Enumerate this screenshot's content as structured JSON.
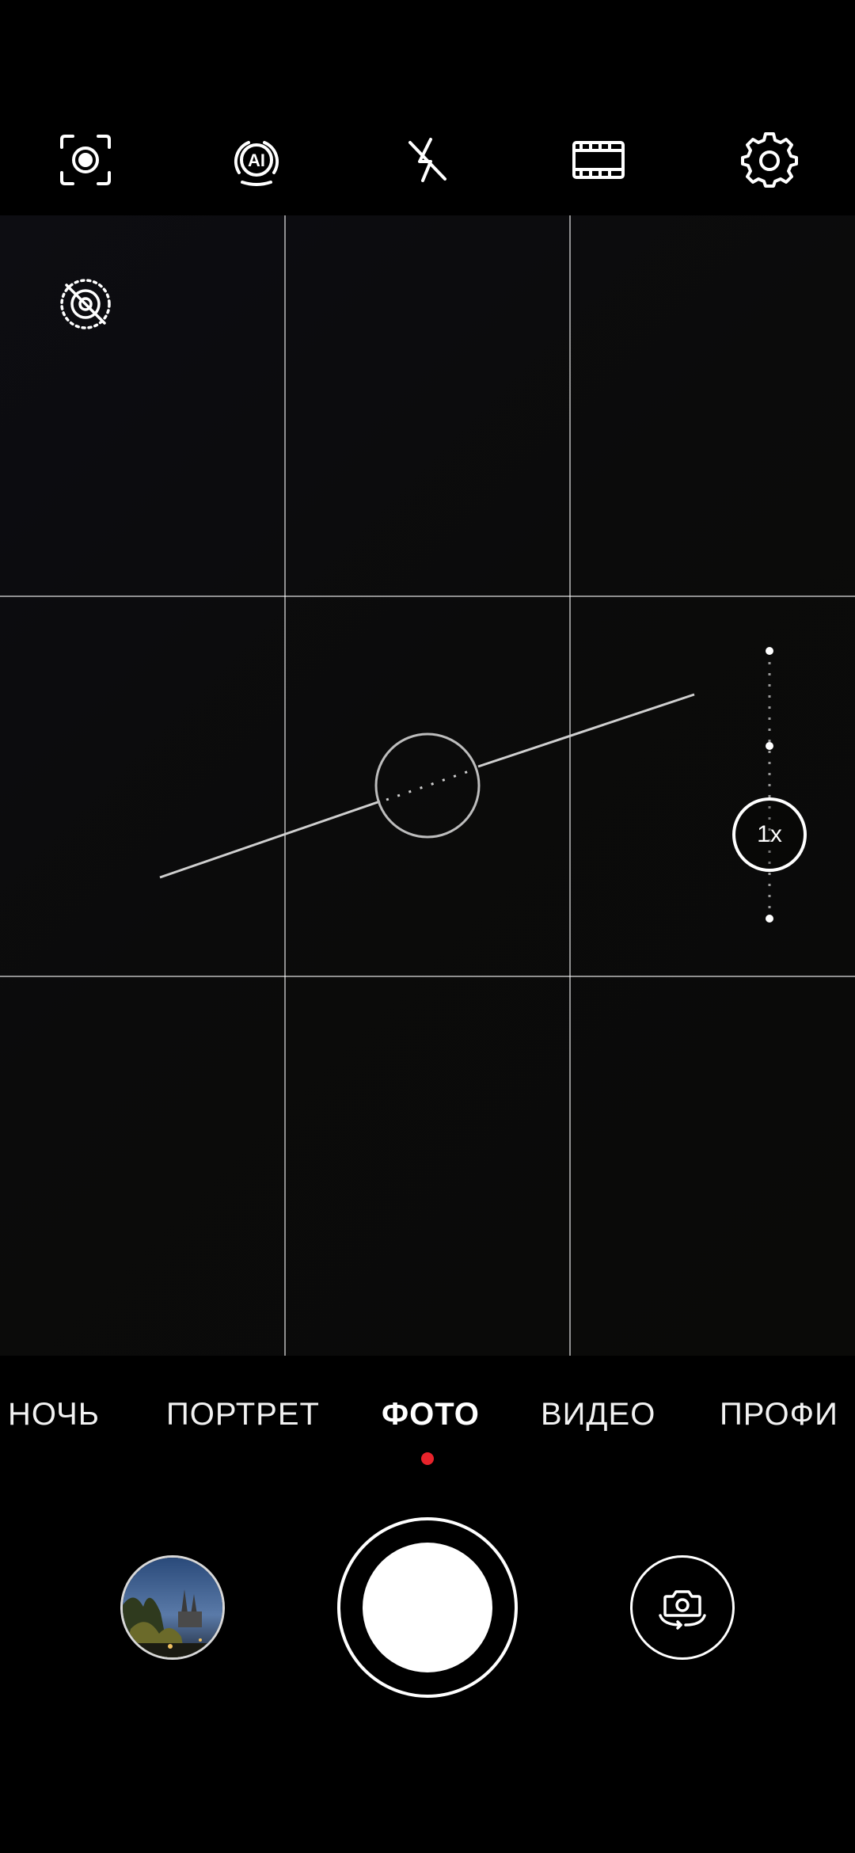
{
  "toolbar": {
    "icons": [
      "focus-icon",
      "ai-icon",
      "flash-off-icon",
      "aspect-ratio-icon",
      "gear-icon"
    ]
  },
  "viewfinder": {
    "overlays": [
      "grid",
      "level-indicator",
      "hdr-off-icon"
    ],
    "zoom": {
      "label": "1x",
      "stops": 3
    }
  },
  "modes": {
    "items": [
      "НОЧЬ",
      "ПОРТРЕТ",
      "ФОТО",
      "ВИДЕО",
      "ПРОФИ"
    ],
    "active": "ФОТО",
    "indicator_color": "#e8232b"
  },
  "controls": {
    "gallery_icon": "gallery-thumbnail",
    "shutter_icon": "shutter-button",
    "switch_icon": "switch-camera-icon"
  },
  "colors": {
    "background": "#000000",
    "foreground": "#ffffff",
    "accent": "#e8232b"
  }
}
